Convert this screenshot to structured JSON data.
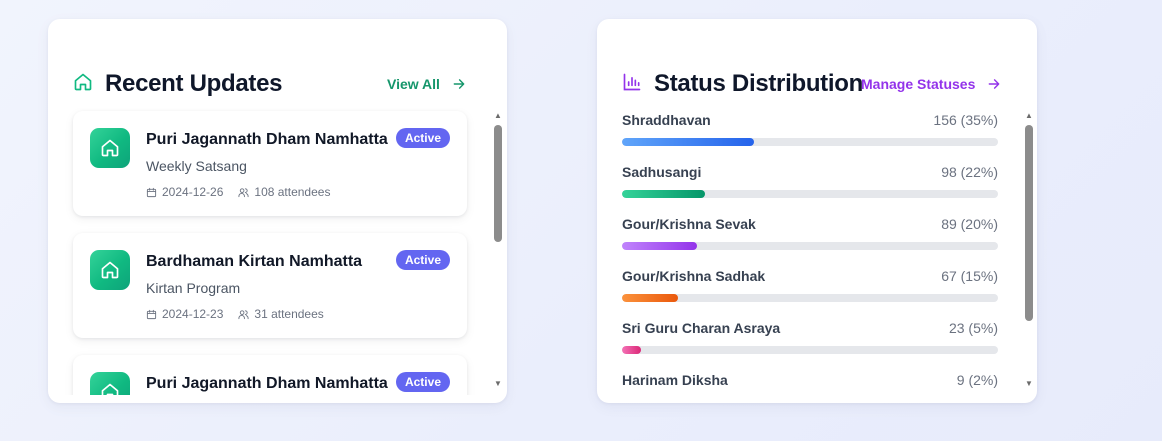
{
  "updates_card": {
    "title": "Recent Updates",
    "icon": "home-icon",
    "view_all_label": "View All",
    "items": [
      {
        "title": "Puri Jagannath Dham Namhatta",
        "subtitle": "Weekly Satsang",
        "date": "2024-12-26",
        "attendees": "108 attendees",
        "badge": "Active",
        "icon": "home-icon"
      },
      {
        "title": "Bardhaman Kirtan Namhatta",
        "subtitle": "Kirtan Program",
        "date": "2024-12-23",
        "attendees": "31 attendees",
        "badge": "Active",
        "icon": "home-icon"
      },
      {
        "title": "Puri Jagannath Dham Namhatta",
        "subtitle": "",
        "date": "",
        "attendees": "",
        "badge": "Active",
        "icon": "home-icon"
      }
    ]
  },
  "status_card": {
    "title": "Status Distribution",
    "icon": "bar-chart-icon",
    "manage_label": "Manage Statuses",
    "items": [
      {
        "name": "Shraddhavan",
        "value": "156 (35%)",
        "fraction": 0.35,
        "color_start": "#60a5fa",
        "color_end": "#2563eb"
      },
      {
        "name": "Sadhusangi",
        "value": "98 (22%)",
        "fraction": 0.22,
        "color_start": "#34d399",
        "color_end": "#059669"
      },
      {
        "name": "Gour/Krishna Sevak",
        "value": "89 (20%)",
        "fraction": 0.2,
        "color_start": "#c084fc",
        "color_end": "#9333ea"
      },
      {
        "name": "Gour/Krishna Sadhak",
        "value": "67 (15%)",
        "fraction": 0.15,
        "color_start": "#fb923c",
        "color_end": "#ea580c"
      },
      {
        "name": "Sri Guru Charan Asraya",
        "value": "23 (5%)",
        "fraction": 0.05,
        "color_start": "#f472b6",
        "color_end": "#db2777"
      },
      {
        "name": "Harinam Diksha",
        "value": "9 (2%)",
        "fraction": 0.02,
        "color_start": "#a3a3a3",
        "color_end": "#6b7280"
      }
    ]
  },
  "colors": {
    "updates_accent": "#15966b",
    "status_accent": "#9333ea",
    "badge": "#6366f1"
  }
}
